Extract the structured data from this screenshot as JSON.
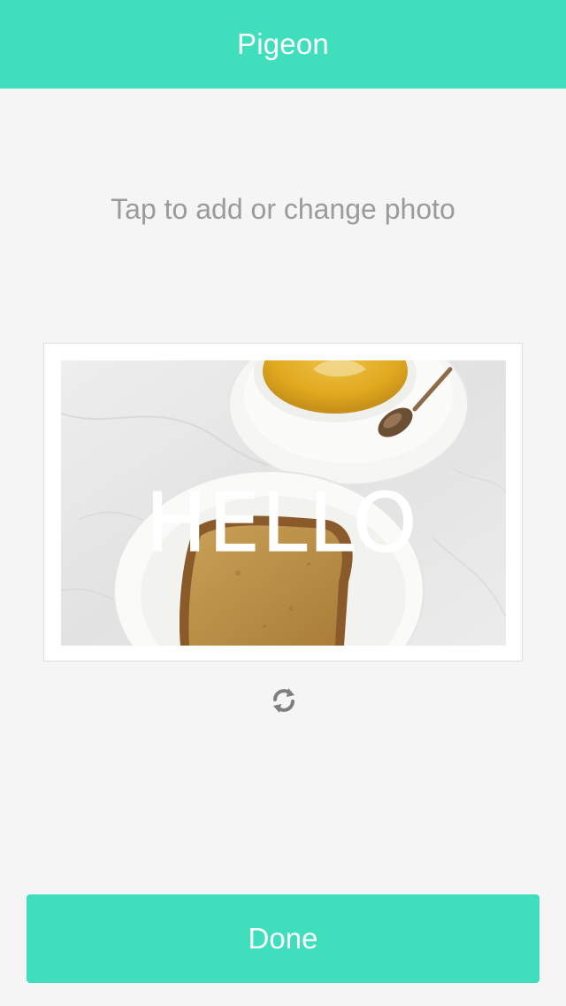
{
  "app": {
    "title": "Pigeon"
  },
  "main": {
    "hint_text": "Tap to add or change photo",
    "card": {
      "overlay_text": "HELLO"
    }
  },
  "actions": {
    "done_label": "Done"
  },
  "icons": {
    "refresh": "refresh-icon"
  },
  "colors": {
    "accent": "#3fdfbd",
    "background": "#f5f5f5",
    "hint_text": "#9b9b9b",
    "refresh_icon": "#7f7f7f"
  }
}
